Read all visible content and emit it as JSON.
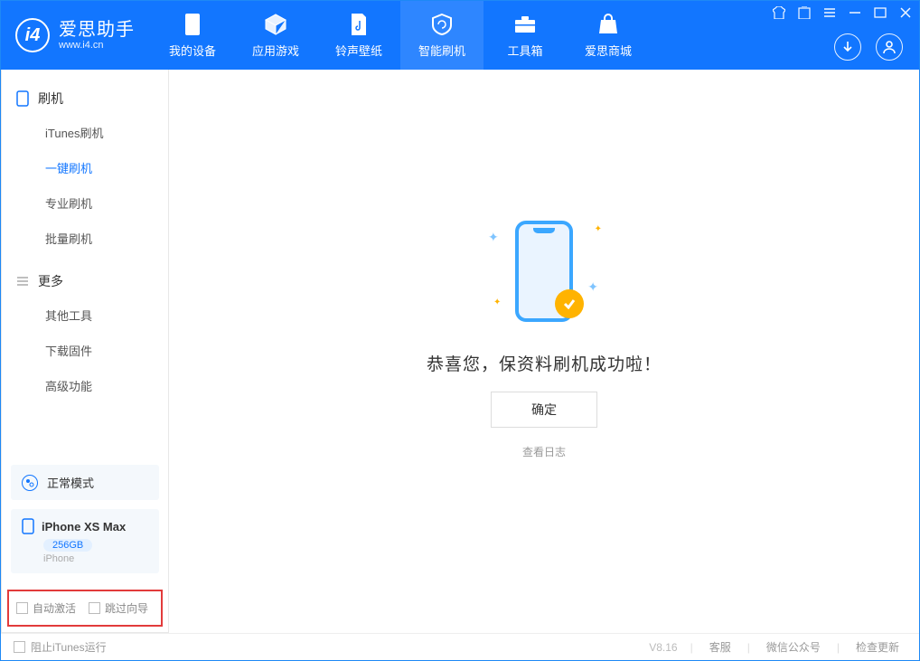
{
  "app": {
    "name": "爱思助手",
    "url": "www.i4.cn"
  },
  "header_tabs": [
    {
      "label": "我的设备"
    },
    {
      "label": "应用游戏"
    },
    {
      "label": "铃声壁纸"
    },
    {
      "label": "智能刷机"
    },
    {
      "label": "工具箱"
    },
    {
      "label": "爱思商城"
    }
  ],
  "sidebar": {
    "section1_title": "刷机",
    "items1": [
      {
        "label": "iTunes刷机"
      },
      {
        "label": "一键刷机"
      },
      {
        "label": "专业刷机"
      },
      {
        "label": "批量刷机"
      }
    ],
    "section2_title": "更多",
    "items2": [
      {
        "label": "其他工具"
      },
      {
        "label": "下载固件"
      },
      {
        "label": "高级功能"
      }
    ]
  },
  "device": {
    "mode": "正常模式",
    "name": "iPhone XS Max",
    "storage": "256GB",
    "type": "iPhone"
  },
  "checkboxes": {
    "auto_activate": "自动激活",
    "skip_guide": "跳过向导"
  },
  "main": {
    "success": "恭喜您，保资料刷机成功啦！",
    "ok": "确定",
    "view_log": "查看日志"
  },
  "footer": {
    "block_itunes": "阻止iTunes运行",
    "version": "V8.16",
    "support": "客服",
    "wechat": "微信公众号",
    "update": "检查更新"
  }
}
